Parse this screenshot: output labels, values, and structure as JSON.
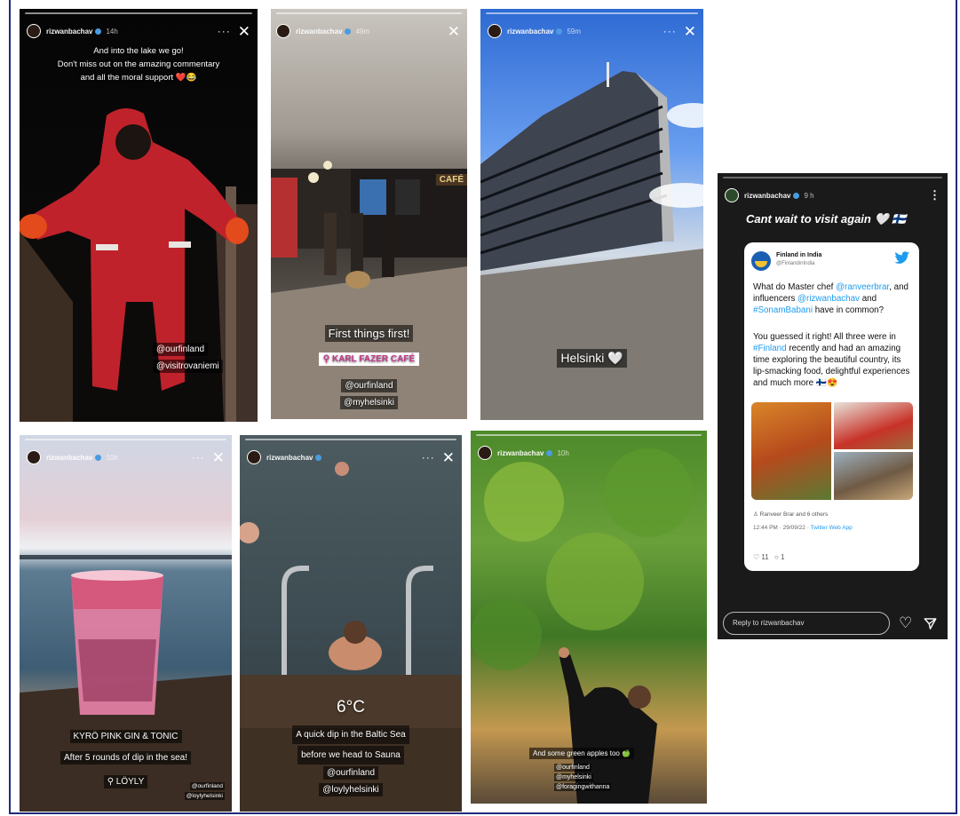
{
  "stories": {
    "s1": {
      "user": "rizwanbachav",
      "time": "14h",
      "caption": [
        "And into the lake we go!",
        "Don't miss out on the amazing commentary",
        "and all the moral support ❤️😂"
      ],
      "tags": [
        "@ourfinland",
        "@visitrovaniemi"
      ]
    },
    "s2": {
      "user": "rizwanbachav",
      "time": "49m",
      "caption": "First things first!",
      "location": "KARL FAZER CAFÉ",
      "tags": [
        "@ourfinland",
        "@myhelsinki"
      ],
      "sign": "CAFÉ"
    },
    "s3": {
      "user": "rizwanbachav",
      "time": "59m",
      "caption": "Helsinki 🤍"
    },
    "s4": {
      "user": "rizwanbachav",
      "time": "10h",
      "lines": [
        "KYRÖ PINK GIN & TONIC",
        "After 5 rounds of dip in the sea!"
      ],
      "location": "LÖYLY",
      "tags": [
        "@ourfinland",
        "@loylyhelsinki"
      ]
    },
    "s5": {
      "user": "rizwanbachav",
      "temp": "6°C",
      "caption": [
        "A quick dip in the Baltic Sea",
        "before we head to Sauna"
      ],
      "tags": [
        "@ourfinland",
        "@loylyhelsinki"
      ]
    },
    "s6": {
      "user": "rizwanbachav",
      "time": "10h",
      "caption": "And some green apples too 🍏",
      "tags": [
        "@ourfinland",
        "@myhelsinki",
        "@foragingwithanna"
      ]
    },
    "s7": {
      "user": "rizwanbachav",
      "time": "9 h",
      "headline": "Cant wait to visit again 🤍 🇫🇮",
      "tweet": {
        "name": "Finland in India",
        "handle": "@FinlandinIndia",
        "p1": [
          "What do Master chef ",
          "@ranveerbrar",
          ",",
          "and influencers ",
          "@rizwanbachav",
          " and",
          "#SonamBabani",
          " have in common?"
        ],
        "p2": [
          "You guessed it right! All three were in ",
          "#Finland",
          " recently and had an amazing time exploring the beautiful country, its lip-smacking food, delightful experiences and much more 🇫🇮😍"
        ],
        "likes": "Ranveer Brar and 6 others",
        "timestamp": "12:44 PM · 29/09/22 · ",
        "source": "Twitter Web App",
        "replies": "11",
        "retweets": "1"
      },
      "reply_placeholder": "Reply to rizwanbachav"
    }
  },
  "icons": {
    "close": "close-icon",
    "more": "more-icon",
    "heart": "heart-icon",
    "send": "send-icon",
    "verified": "verified-badge-icon",
    "twitter": "twitter-bird-icon"
  },
  "colors": {
    "border": "#1f2a7a",
    "twitter_blue": "#1d9bf0",
    "location_pink": "#c23a8a"
  }
}
